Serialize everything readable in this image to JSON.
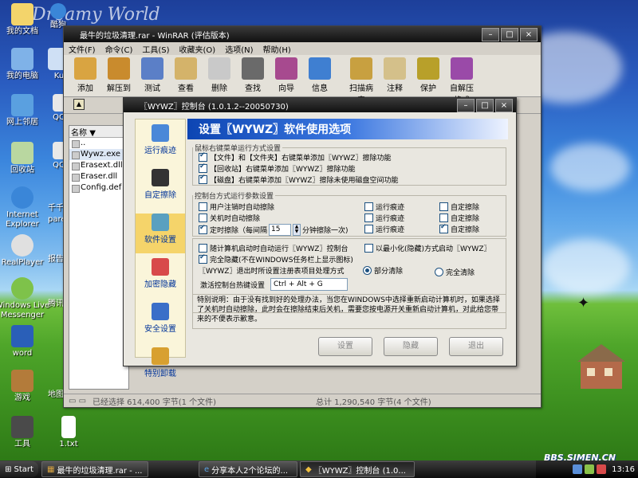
{
  "desktop": {
    "brand": "Dreamy World",
    "icons": [
      {
        "label": "我的文档",
        "color": "#f3d46b"
      },
      {
        "label": "我的电脑",
        "color": "#7fb2e8"
      },
      {
        "label": "网上邻居",
        "color": "#5aa0e0"
      },
      {
        "label": "回收站",
        "color": "#b9d7a0"
      },
      {
        "label": "Internet Explorer",
        "color": "#3a86d8"
      },
      {
        "label": "RealPlayer",
        "color": "#e0e0e0"
      },
      {
        "label": "Windows Live Messenger",
        "color": "#7ec24a"
      },
      {
        "label": "word",
        "color": "#2a5fb8"
      },
      {
        "label": "游戏",
        "color": "#b37b3a"
      },
      {
        "label": "工具",
        "color": "#4a4a4a"
      },
      {
        "label": "Ku",
        "color": "#cfe0f5"
      },
      {
        "label": "QQ",
        "color": "#e8e8e8"
      },
      {
        "label": "1.txt",
        "color": "#ffffff"
      }
    ],
    "partial_labels": [
      "酷狗",
      "QQ",
      "QQ",
      "千千",
      "pare",
      "报告",
      "腾讯",
      "地图"
    ]
  },
  "winrar": {
    "title": "最牛的垃圾清理.rar - WinRAR (评估版本)",
    "menu": [
      "文件(F)",
      "命令(C)",
      "工具(S)",
      "收藏夹(O)",
      "选项(N)",
      "帮助(H)"
    ],
    "tools": [
      {
        "label": "添加",
        "icon": "add-archive-icon",
        "color": "#d9a441"
      },
      {
        "label": "解压到",
        "icon": "extract-icon",
        "color": "#c98b2d"
      },
      {
        "label": "测试",
        "icon": "test-icon",
        "color": "#5b7fc7"
      },
      {
        "label": "查看",
        "icon": "view-icon",
        "color": "#d4b36a"
      },
      {
        "label": "删除",
        "icon": "delete-icon",
        "color": "#c9c9c9"
      },
      {
        "label": "查找",
        "icon": "find-icon",
        "color": "#6a6a6a"
      },
      {
        "label": "向导",
        "icon": "wizard-icon",
        "color": "#a74a8f"
      },
      {
        "label": "信息",
        "icon": "info-icon",
        "color": "#3f7fd1"
      },
      {
        "label": "扫描病毒",
        "icon": "virus-scan-icon",
        "color": "#c8a040"
      },
      {
        "label": "注释",
        "icon": "comment-icon",
        "color": "#d4c08a"
      },
      {
        "label": "保护",
        "icon": "protect-icon",
        "color": "#b8a02a"
      },
      {
        "label": "自解压格式",
        "icon": "sfx-icon",
        "color": "#9a4aa8"
      }
    ],
    "name_header": "名称",
    "files": [
      "..",
      "Wywz.exe",
      "Erasext.dll",
      "Eraser.dll",
      "Config.def"
    ],
    "status_left": "已经选择 614,400 字节(1 个文件)",
    "status_right": "总计 1,290,540 字节(4 个文件)"
  },
  "dialog": {
    "title": "〖WYWZ〗控制台 (1.0.1.2--20050730)",
    "header": "设置〖WYWZ〗软件使用选项",
    "sidebar": [
      {
        "label": "运行痕迹",
        "color": "#4a88d8"
      },
      {
        "label": "自定擦除",
        "color": "#333333"
      },
      {
        "label": "软件设置",
        "color": "#5aa0c0"
      },
      {
        "label": "加密隐藏",
        "color": "#d84a4a"
      },
      {
        "label": "安全设置",
        "color": "#3a6fc8"
      },
      {
        "label": "特别卸载",
        "color": "#d8a030"
      }
    ],
    "group1": {
      "title": "鼠标右键菜单运行方式设置",
      "items": [
        "【文件】和【文件夹】右键菜单添加〖WYWZ〗擦除功能",
        "【回收站】右键菜单添加〖WYWZ〗擦除功能",
        "【磁盘】右键菜单添加〖WYWZ〗擦除未使用磁盘空间功能"
      ]
    },
    "group2": {
      "title": "控制台方式运行参数设置",
      "col1": [
        "用户注销时自动擦除",
        "关机时自动擦除",
        "定时擦除（每间隔"
      ],
      "interval": "15",
      "interval_suffix": "分钟擦除一次)",
      "col2": [
        "运行痕迹",
        "运行痕迹",
        "运行痕迹"
      ],
      "col3": [
        "自定擦除",
        "自定擦除",
        "自定擦除"
      ]
    },
    "group3": {
      "auto_start": "随计算机启动时自动运行〖WYWZ〗控制台",
      "minimized": "以最小化(隐藏)方式启动〖WYWZ〗",
      "hidden": "完全隐藏(不在WINDOWS任务栏上显示图标)",
      "exit_label": "〖WYWZ〗退出时所设置注册表项目处理方式",
      "partial_clear": "部分清除",
      "full_clear": "完全清除",
      "hotkey_label": "激活控制台热键设置",
      "hotkey_value": "Ctrl + Alt + G"
    },
    "note": "特别说明：由于没有找到好的处理办法，当您在WINDOWS中选择重新启动计算机时，如果选择了关机时自动擦除，此时会在擦除结束后关机，需要您按电源开关重新启动计算机，对此给您带来的不便表示歉意。",
    "buttons": [
      "设置",
      "隐藏",
      "退出"
    ]
  },
  "taskbar": {
    "start": "Start",
    "tasks": [
      "最牛的垃圾清理.rar - ...",
      "分享本人2个论坛的...",
      "〖WYWZ〗控制台 (1.0..."
    ],
    "clock": "13:16"
  },
  "watermark": "BBS.SIMEN.CN"
}
